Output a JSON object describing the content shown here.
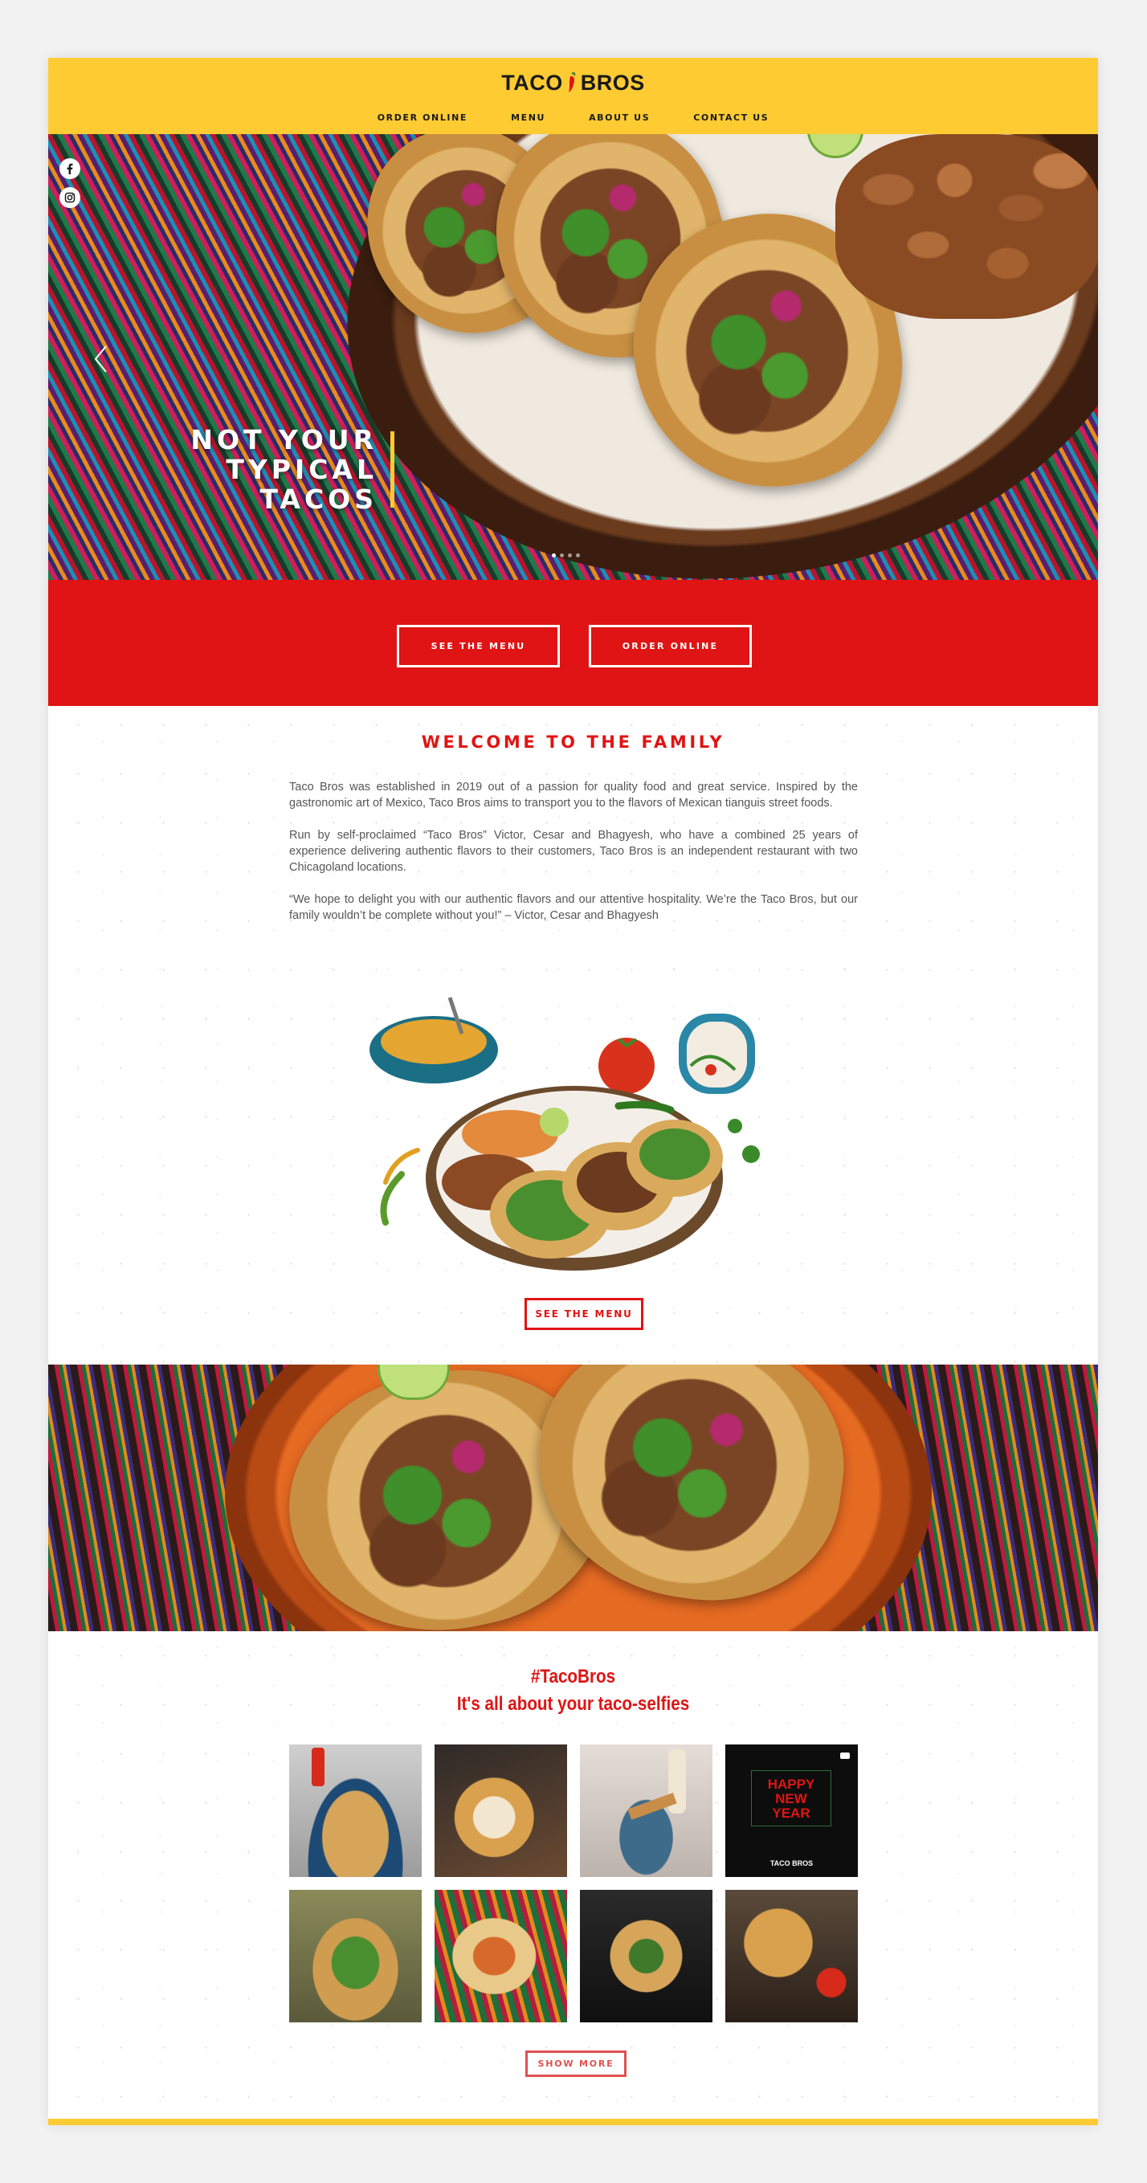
{
  "brand": {
    "name_left": "TACO",
    "name_right": "BROS"
  },
  "nav": [
    "ORDER ONLINE",
    "MENU",
    "ABOUT US",
    "CONTACT US"
  ],
  "social": [
    "facebook-icon",
    "instagram-icon"
  ],
  "hero": {
    "title_lines": [
      "NOT YOUR",
      "TYPICAL",
      "TACOS"
    ],
    "slide_count": 4,
    "active_slide": 1
  },
  "cta": {
    "see_menu": "SEE THE MENU",
    "order_online": "ORDER ONLINE"
  },
  "welcome": {
    "title": "WELCOME TO THE FAMILY",
    "paragraphs": [
      "Taco Bros was established in 2019 out of a passion for quality food and great service. Inspired by the gastronomic art of Mexico, Taco Bros aims to transport you to the flavors of Mexican tianguis street foods.",
      "Run by self-proclaimed “Taco Bros” Victor, Cesar and Bhagyesh, who have a combined 25 years of experience delivering authentic flavors to their customers, Taco Bros is an independent restaurant with two Chicagoland locations.",
      "“We hope to delight you with our authentic flavors and our attentive hospitality. We’re the Taco Bros, but our family wouldn’t be complete without you!” – Victor, Cesar and Bhagyesh"
    ],
    "button": "SEE THE MENU"
  },
  "selfies": {
    "hashtag": "#TacoBros",
    "subtitle": "It's all about your taco-selfies",
    "new_year": [
      "HAPPY",
      "NEW",
      "YEAR"
    ],
    "more_button": "SHOW MORE"
  },
  "colors": {
    "yellow": "#ffcb33",
    "red": "#e01414"
  }
}
